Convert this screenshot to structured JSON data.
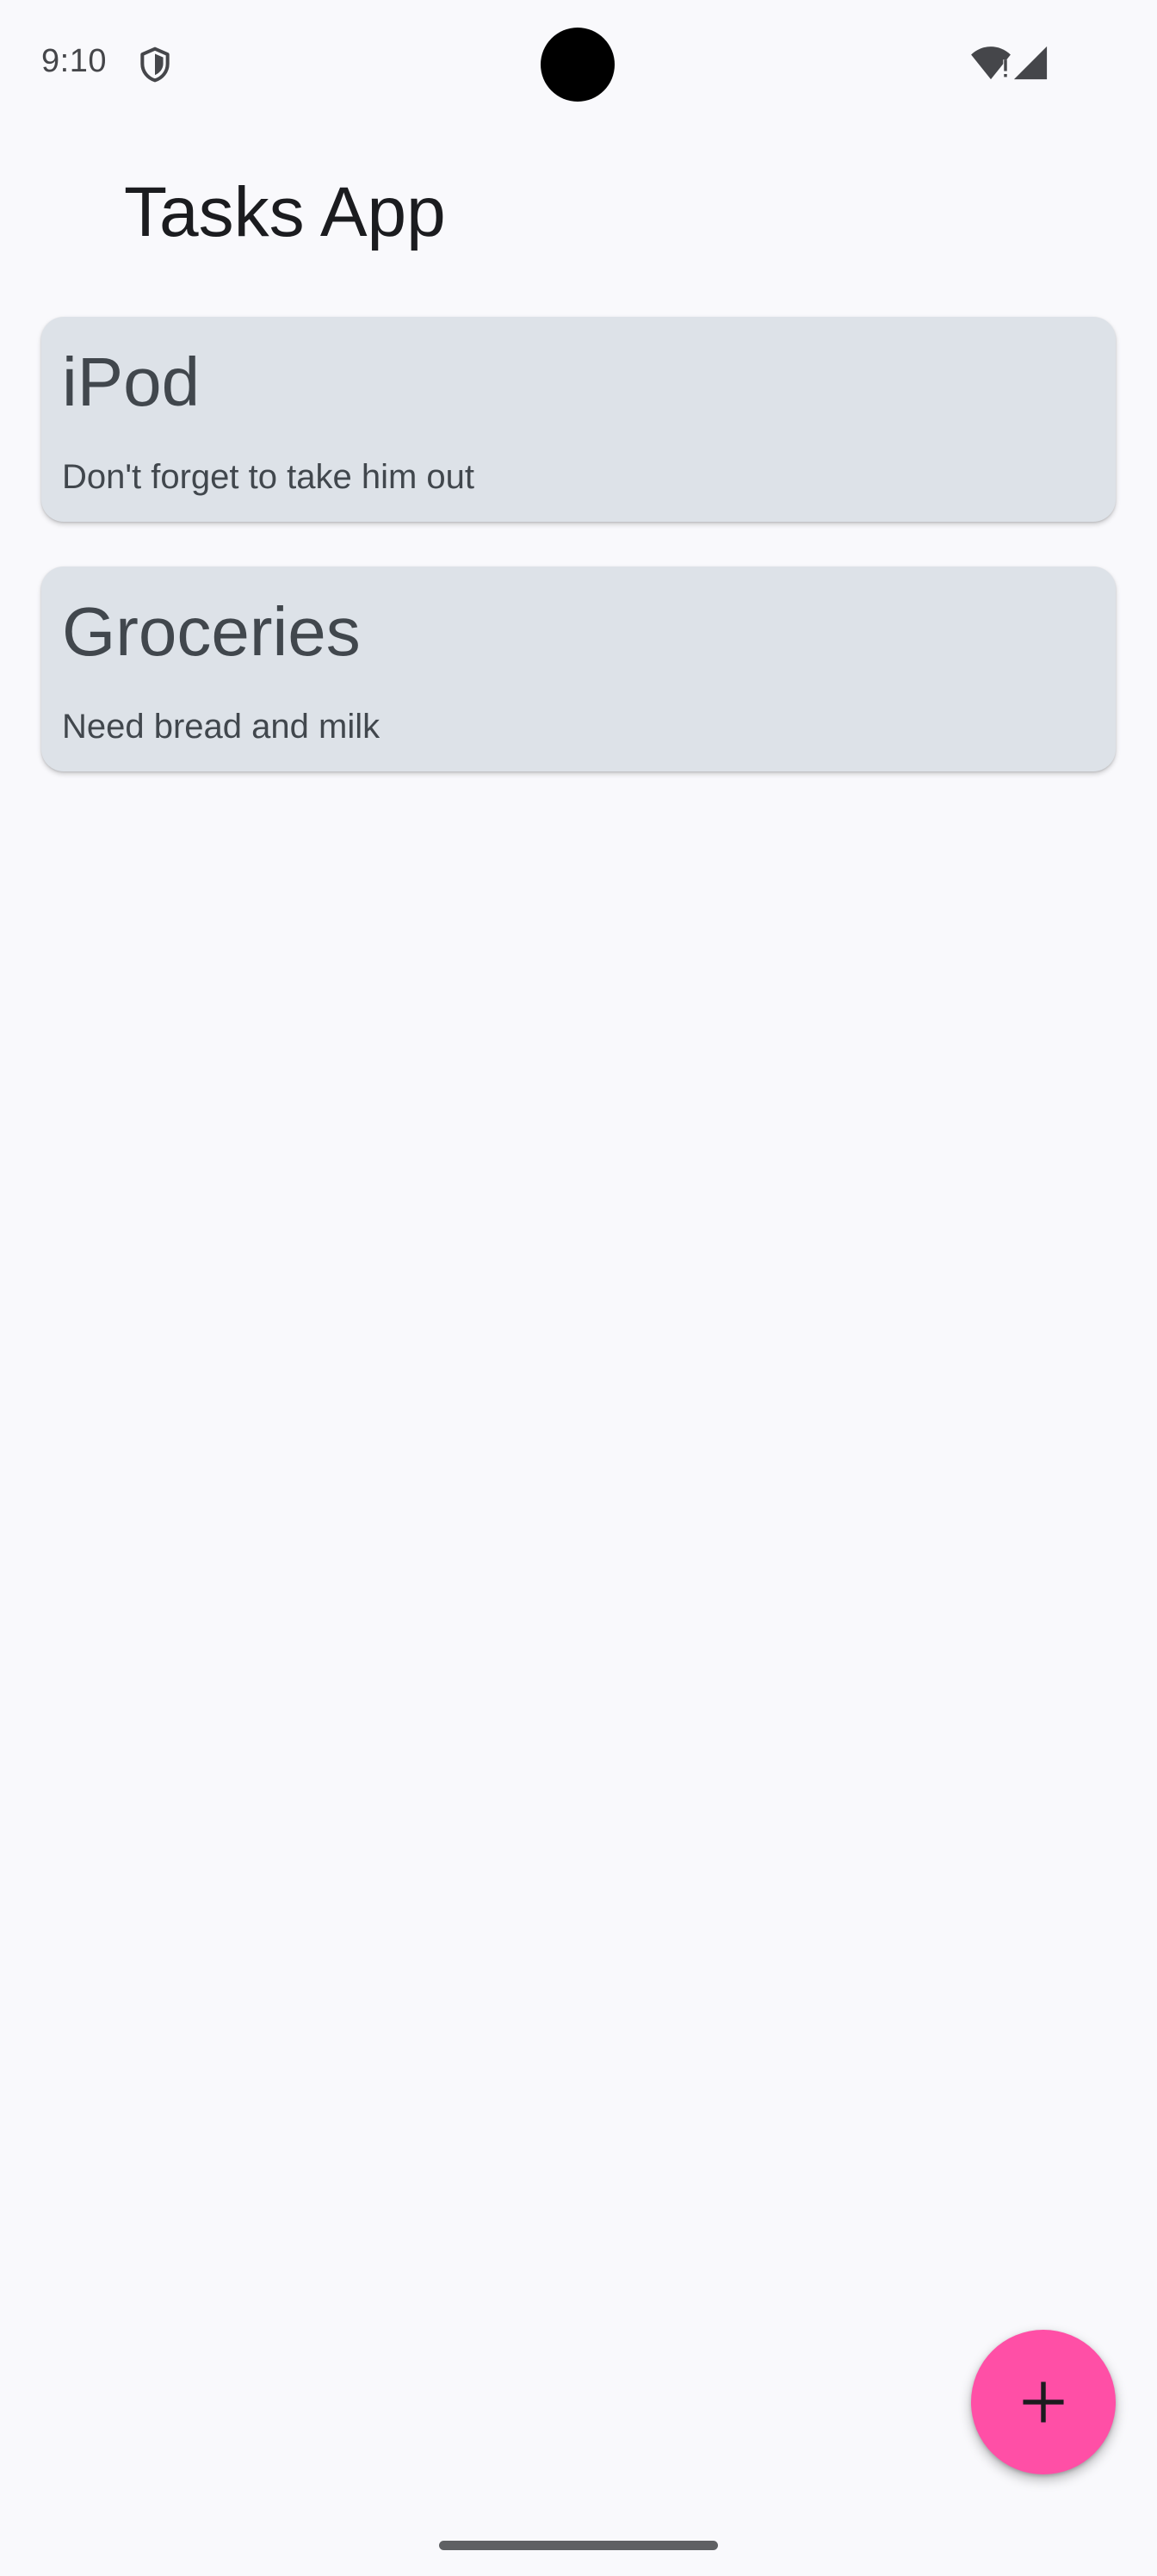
{
  "status_bar": {
    "time": "9:10",
    "icons": [
      "shield-icon",
      "wifi-icon",
      "signal-icon"
    ]
  },
  "app_bar": {
    "title": "Tasks App"
  },
  "tasks": [
    {
      "title": "iPod",
      "description": "Don't forget to take him out"
    },
    {
      "title": "Groceries",
      "description": "Need bread and milk"
    }
  ],
  "fab": {
    "icon": "plus-icon",
    "color": "#ff4fa6"
  },
  "colors": {
    "background": "#f9f9fc",
    "card": "#dde2e8",
    "card_text": "#41474d"
  }
}
